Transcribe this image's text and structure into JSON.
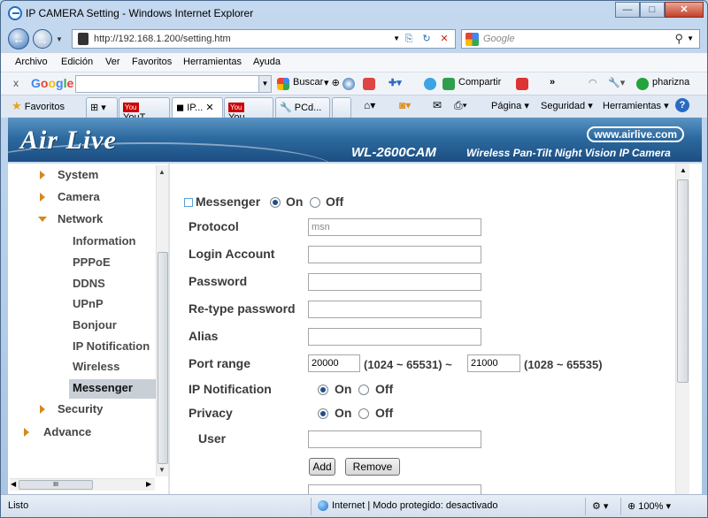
{
  "window": {
    "title": "IP CAMERA Setting - Windows Internet Explorer",
    "min": "—",
    "max": "□",
    "close": "✕"
  },
  "address": {
    "url": "http://192.168.1.200/setting.htm"
  },
  "search": {
    "placeholder": "Google"
  },
  "menu": [
    "Archivo",
    "Edición",
    "Ver",
    "Favoritos",
    "Herramientas",
    "Ayuda"
  ],
  "google_toolbar": {
    "close": "x",
    "logo": "Google",
    "buscar": "Buscar",
    "compartir": "Compartir",
    "more": "»",
    "user": "pharizna"
  },
  "tabs": {
    "favorites": "Favoritos",
    "items": [
      "YouT...",
      "IP...",
      "You...",
      "PCd..."
    ]
  },
  "command_bar": {
    "pagina": "Página",
    "seguridad": "Seguridad",
    "herramientas": "Herramientas",
    "help": "?"
  },
  "banner": {
    "logo": "Air Live",
    "url": "www.airlive.com",
    "model": "WL-2600CAM",
    "desc": "Wireless Pan-Tilt Night Vision IP Camera"
  },
  "nav": {
    "top": [
      "System",
      "Camera",
      "Network"
    ],
    "network_sub": [
      "Information",
      "PPPoE",
      "DDNS",
      "UPnP",
      "Bonjour",
      "IP Notification",
      "Wireless",
      "Messenger"
    ],
    "bottom": [
      "Security",
      "Advance"
    ],
    "scroll_label": "III"
  },
  "form": {
    "section": "Messenger",
    "on": "On",
    "off": "Off",
    "protocol_label": "Protocol",
    "protocol_value": "msn",
    "login_label": "Login Account",
    "password_label": "Password",
    "retype_label": "Re-type password",
    "alias_label": "Alias",
    "port_label": "Port range",
    "port_from": "20000",
    "port_from_range": "(1024 ~ 65531) ~",
    "port_to": "21000",
    "port_to_range": "(1028 ~ 65535)",
    "ipnotif_label": "IP Notification",
    "privacy_label": "Privacy",
    "user_label": "User",
    "add": "Add",
    "remove": "Remove"
  },
  "status": {
    "left": "Listo",
    "zone": "Internet | Modo protegido: desactivado",
    "zoom": "100%"
  }
}
